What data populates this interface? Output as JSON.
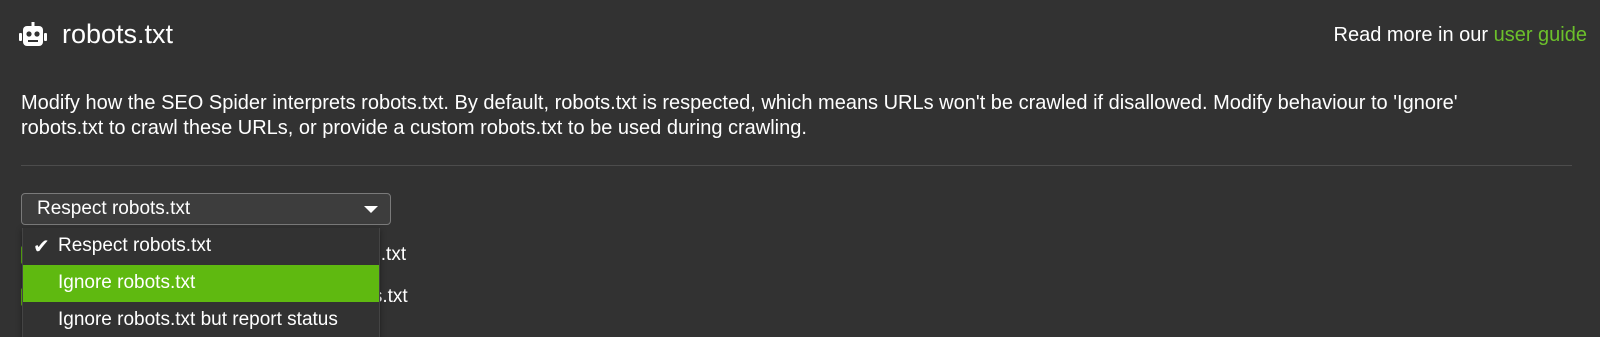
{
  "header": {
    "title": "robots.txt",
    "icon": "robot-icon",
    "read_more_prefix": "Read more in our ",
    "read_more_link": "user guide"
  },
  "description": "Modify how the SEO Spider interprets robots.txt. By default, robots.txt is respected, which means URLs won't be crawled if disallowed. Modify behaviour to 'Ignore' robots.txt to crawl these URLs, or provide a custom robots.txt to be used during crawling.",
  "select": {
    "value": "Respect robots.txt",
    "options": [
      {
        "label": "Respect robots.txt",
        "checked": true
      },
      {
        "label": "Ignore robots.txt",
        "highlighted": true
      },
      {
        "label": "Ignore robots.txt but report status"
      }
    ]
  },
  "behind": {
    "row1_suffix": "ts.txt",
    "row2_suffix": "ots.txt"
  },
  "colors": {
    "background": "#323232",
    "accent": "#5fb910",
    "link": "#6cc02b"
  }
}
